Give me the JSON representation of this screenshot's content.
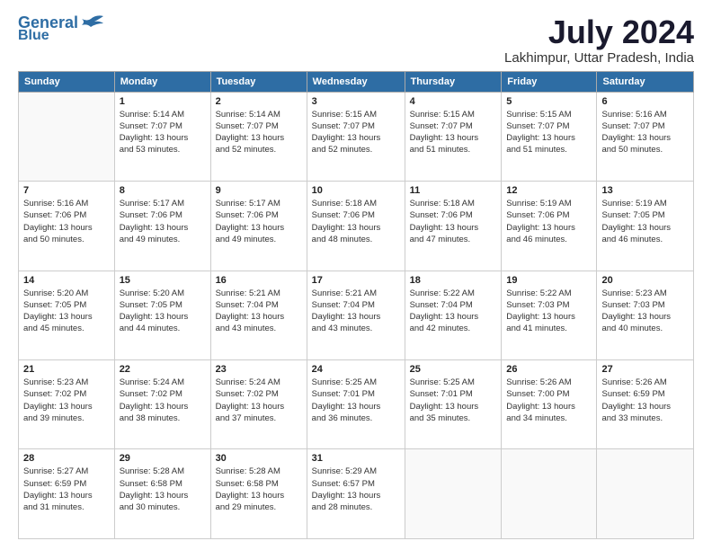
{
  "logo": {
    "line1": "General",
    "line2": "Blue"
  },
  "title": "July 2024",
  "location": "Lakhimpur, Uttar Pradesh, India",
  "days": [
    "Sunday",
    "Monday",
    "Tuesday",
    "Wednesday",
    "Thursday",
    "Friday",
    "Saturday"
  ],
  "weeks": [
    [
      {
        "date": "",
        "info": ""
      },
      {
        "date": "1",
        "info": "Sunrise: 5:14 AM\nSunset: 7:07 PM\nDaylight: 13 hours\nand 53 minutes."
      },
      {
        "date": "2",
        "info": "Sunrise: 5:14 AM\nSunset: 7:07 PM\nDaylight: 13 hours\nand 52 minutes."
      },
      {
        "date": "3",
        "info": "Sunrise: 5:15 AM\nSunset: 7:07 PM\nDaylight: 13 hours\nand 52 minutes."
      },
      {
        "date": "4",
        "info": "Sunrise: 5:15 AM\nSunset: 7:07 PM\nDaylight: 13 hours\nand 51 minutes."
      },
      {
        "date": "5",
        "info": "Sunrise: 5:15 AM\nSunset: 7:07 PM\nDaylight: 13 hours\nand 51 minutes."
      },
      {
        "date": "6",
        "info": "Sunrise: 5:16 AM\nSunset: 7:07 PM\nDaylight: 13 hours\nand 50 minutes."
      }
    ],
    [
      {
        "date": "7",
        "info": "Sunrise: 5:16 AM\nSunset: 7:06 PM\nDaylight: 13 hours\nand 50 minutes."
      },
      {
        "date": "8",
        "info": "Sunrise: 5:17 AM\nSunset: 7:06 PM\nDaylight: 13 hours\nand 49 minutes."
      },
      {
        "date": "9",
        "info": "Sunrise: 5:17 AM\nSunset: 7:06 PM\nDaylight: 13 hours\nand 49 minutes."
      },
      {
        "date": "10",
        "info": "Sunrise: 5:18 AM\nSunset: 7:06 PM\nDaylight: 13 hours\nand 48 minutes."
      },
      {
        "date": "11",
        "info": "Sunrise: 5:18 AM\nSunset: 7:06 PM\nDaylight: 13 hours\nand 47 minutes."
      },
      {
        "date": "12",
        "info": "Sunrise: 5:19 AM\nSunset: 7:06 PM\nDaylight: 13 hours\nand 46 minutes."
      },
      {
        "date": "13",
        "info": "Sunrise: 5:19 AM\nSunset: 7:05 PM\nDaylight: 13 hours\nand 46 minutes."
      }
    ],
    [
      {
        "date": "14",
        "info": "Sunrise: 5:20 AM\nSunset: 7:05 PM\nDaylight: 13 hours\nand 45 minutes."
      },
      {
        "date": "15",
        "info": "Sunrise: 5:20 AM\nSunset: 7:05 PM\nDaylight: 13 hours\nand 44 minutes."
      },
      {
        "date": "16",
        "info": "Sunrise: 5:21 AM\nSunset: 7:04 PM\nDaylight: 13 hours\nand 43 minutes."
      },
      {
        "date": "17",
        "info": "Sunrise: 5:21 AM\nSunset: 7:04 PM\nDaylight: 13 hours\nand 43 minutes."
      },
      {
        "date": "18",
        "info": "Sunrise: 5:22 AM\nSunset: 7:04 PM\nDaylight: 13 hours\nand 42 minutes."
      },
      {
        "date": "19",
        "info": "Sunrise: 5:22 AM\nSunset: 7:03 PM\nDaylight: 13 hours\nand 41 minutes."
      },
      {
        "date": "20",
        "info": "Sunrise: 5:23 AM\nSunset: 7:03 PM\nDaylight: 13 hours\nand 40 minutes."
      }
    ],
    [
      {
        "date": "21",
        "info": "Sunrise: 5:23 AM\nSunset: 7:02 PM\nDaylight: 13 hours\nand 39 minutes."
      },
      {
        "date": "22",
        "info": "Sunrise: 5:24 AM\nSunset: 7:02 PM\nDaylight: 13 hours\nand 38 minutes."
      },
      {
        "date": "23",
        "info": "Sunrise: 5:24 AM\nSunset: 7:02 PM\nDaylight: 13 hours\nand 37 minutes."
      },
      {
        "date": "24",
        "info": "Sunrise: 5:25 AM\nSunset: 7:01 PM\nDaylight: 13 hours\nand 36 minutes."
      },
      {
        "date": "25",
        "info": "Sunrise: 5:25 AM\nSunset: 7:01 PM\nDaylight: 13 hours\nand 35 minutes."
      },
      {
        "date": "26",
        "info": "Sunrise: 5:26 AM\nSunset: 7:00 PM\nDaylight: 13 hours\nand 34 minutes."
      },
      {
        "date": "27",
        "info": "Sunrise: 5:26 AM\nSunset: 6:59 PM\nDaylight: 13 hours\nand 33 minutes."
      }
    ],
    [
      {
        "date": "28",
        "info": "Sunrise: 5:27 AM\nSunset: 6:59 PM\nDaylight: 13 hours\nand 31 minutes."
      },
      {
        "date": "29",
        "info": "Sunrise: 5:28 AM\nSunset: 6:58 PM\nDaylight: 13 hours\nand 30 minutes."
      },
      {
        "date": "30",
        "info": "Sunrise: 5:28 AM\nSunset: 6:58 PM\nDaylight: 13 hours\nand 29 minutes."
      },
      {
        "date": "31",
        "info": "Sunrise: 5:29 AM\nSunset: 6:57 PM\nDaylight: 13 hours\nand 28 minutes."
      },
      {
        "date": "",
        "info": ""
      },
      {
        "date": "",
        "info": ""
      },
      {
        "date": "",
        "info": ""
      }
    ]
  ]
}
